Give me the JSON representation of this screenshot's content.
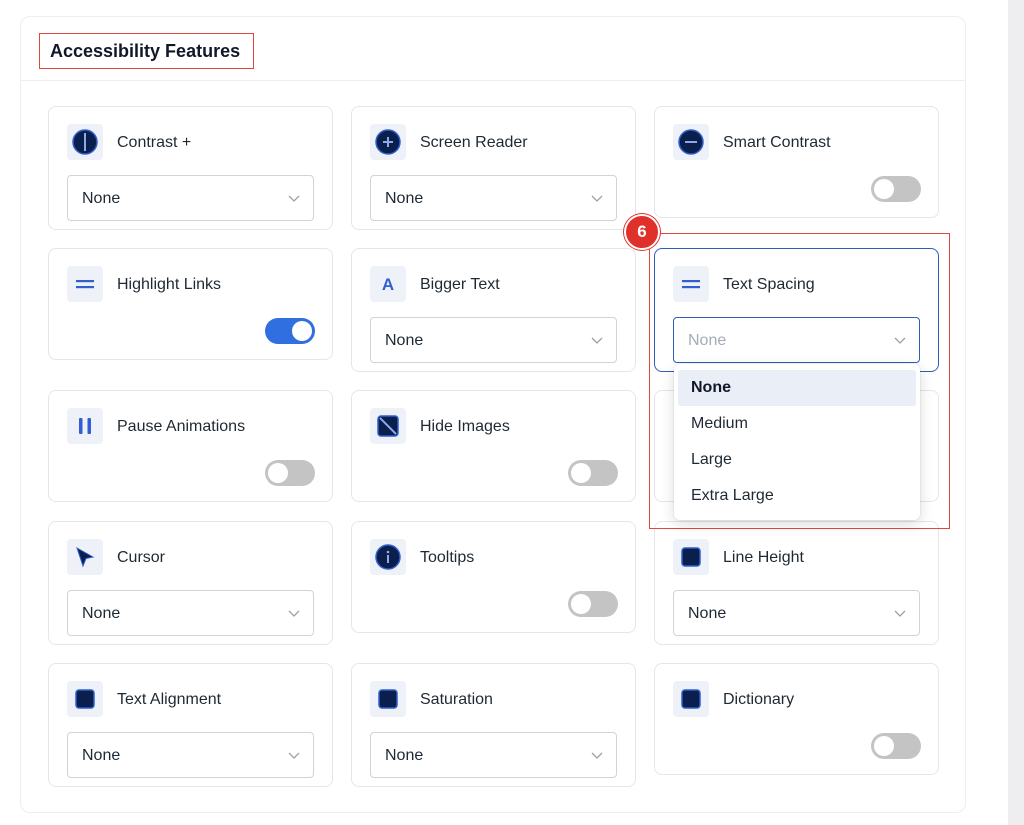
{
  "panel": {
    "title": "Accessibility Features"
  },
  "step_badge": "6",
  "cards": [
    {
      "id": "contrast",
      "label": "Contrast +",
      "icon": "contrast-half-circle-icon",
      "control": "select",
      "value": "None"
    },
    {
      "id": "screen-reader",
      "label": "Screen Reader",
      "icon": "plus-circle-icon",
      "control": "select",
      "value": "None"
    },
    {
      "id": "smart-contrast",
      "label": "Smart Contrast",
      "icon": "minus-circle-icon",
      "control": "toggle",
      "on": false
    },
    {
      "id": "highlight-links",
      "label": "Highlight Links",
      "icon": "equals-lines-icon",
      "control": "toggle",
      "on": true
    },
    {
      "id": "bigger-text",
      "label": "Bigger Text",
      "icon": "letter-a-icon",
      "control": "select",
      "value": "None"
    },
    {
      "id": "text-spacing",
      "label": "Text Spacing",
      "icon": "equals-lines-icon",
      "control": "select",
      "placeholder": "None",
      "open": true
    },
    {
      "id": "pause-animations",
      "label": "Pause Animations",
      "icon": "pause-icon",
      "control": "toggle",
      "on": false
    },
    {
      "id": "hide-images",
      "label": "Hide Images",
      "icon": "hide-image-icon",
      "control": "toggle",
      "on": false
    },
    {
      "id": "cursor",
      "label": "Cursor",
      "icon": "cursor-arrow-icon",
      "control": "select",
      "value": "None"
    },
    {
      "id": "tooltips",
      "label": "Tooltips",
      "icon": "info-circle-icon",
      "control": "toggle",
      "on": false
    },
    {
      "id": "line-height",
      "label": "Line Height",
      "icon": "square-icon",
      "control": "select",
      "value": "None"
    },
    {
      "id": "text-alignment",
      "label": "Text Alignment",
      "icon": "square-icon",
      "control": "select",
      "value": "None"
    },
    {
      "id": "saturation",
      "label": "Saturation",
      "icon": "square-icon",
      "control": "select",
      "value": "None"
    },
    {
      "id": "dictionary",
      "label": "Dictionary",
      "icon": "square-icon",
      "control": "toggle",
      "on": false
    }
  ],
  "text_spacing_dropdown": {
    "options": [
      "None",
      "Medium",
      "Large",
      "Extra Large"
    ],
    "selected": "None"
  },
  "colors": {
    "accent": "#2f6fe0",
    "icon_dark": "#0b1f4d",
    "highlight_red": "#e2463c",
    "toggle_off": "#c4c4c4"
  }
}
